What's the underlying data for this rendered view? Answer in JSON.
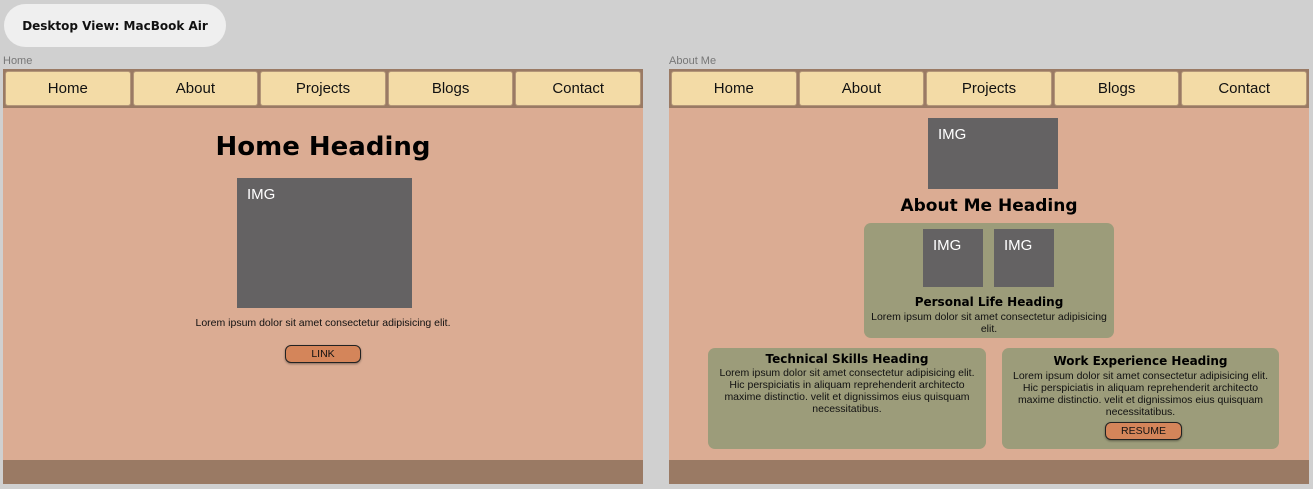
{
  "canvas_label": "Desktop View: MacBook Air",
  "home_frame": {
    "label": "Home",
    "nav": [
      "Home",
      "About",
      "Projects",
      "Blogs",
      "Contact"
    ],
    "heading": "Home Heading",
    "img_label": "IMG",
    "text": "Lorem ipsum dolor sit amet consectetur adipisicing elit.",
    "button": "LINK"
  },
  "about_frame": {
    "label": "About Me",
    "nav": [
      "Home",
      "About",
      "Projects",
      "Blogs",
      "Contact"
    ],
    "img_label": "IMG",
    "heading": "About Me Heading",
    "personal": {
      "img1": "IMG",
      "img2": "IMG",
      "title": "Personal Life Heading",
      "text": "Lorem ipsum dolor sit amet consectetur adipisicing elit."
    },
    "technical": {
      "title": "Technical Skills Heading",
      "text": "Lorem ipsum dolor sit amet consectetur adipisicing elit. Hic perspiciatis in aliquam reprehenderit architecto maxime distinctio. velit et dignissimos eius quisquam necessitatibus."
    },
    "work": {
      "title": "Work Experience Heading",
      "text": "Lorem ipsum dolor sit amet consectetur adipisicing elit. Hic perspiciatis in aliquam reprehenderit architecto maxime distinctio. velit et dignissimos eius quisquam necessitatibus.",
      "button": "RESUME"
    }
  },
  "colors": {
    "canvas": "#d0d0d0",
    "frame_bg": "#dbac93",
    "nav_bg": "#9a7a64",
    "nav_item": "#f3dba6",
    "img_placeholder": "#646263",
    "card_bg": "#9c9c7a",
    "button_bg": "#d4855a"
  }
}
